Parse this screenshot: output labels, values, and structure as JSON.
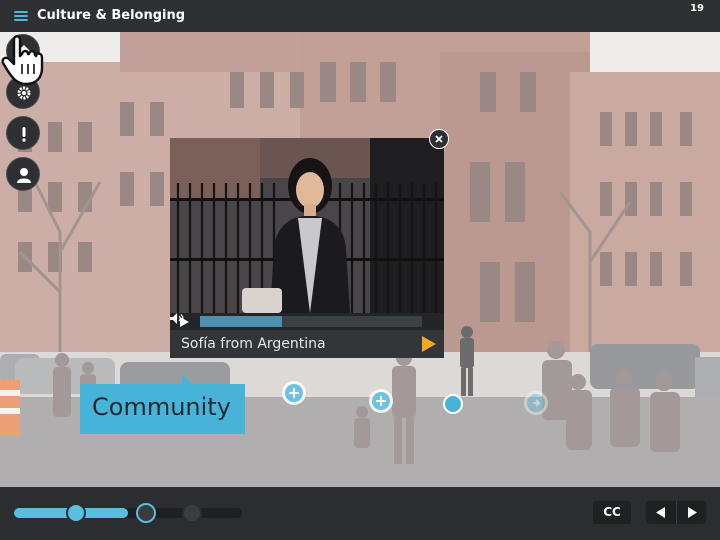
{
  "header": {
    "title": "Culture & Belonging",
    "page_number": "19"
  },
  "video": {
    "caption": "Sofía from Argentina",
    "progress": 0.37
  },
  "community_label": "Community",
  "controls": {
    "cc_label": "CC",
    "timeline_progress": 0.5
  },
  "colors": {
    "accent": "#47b3d9",
    "play_button": "#f4a81d",
    "bar": "#2e3033"
  },
  "icons": [
    "menu-icon",
    "home-icon",
    "gear-icon",
    "alert-icon",
    "user-icon",
    "close-icon",
    "play-icon",
    "volume-icon",
    "plus-icon",
    "hand-pointer-icon",
    "prev-arrow-icon",
    "next-arrow-icon"
  ]
}
